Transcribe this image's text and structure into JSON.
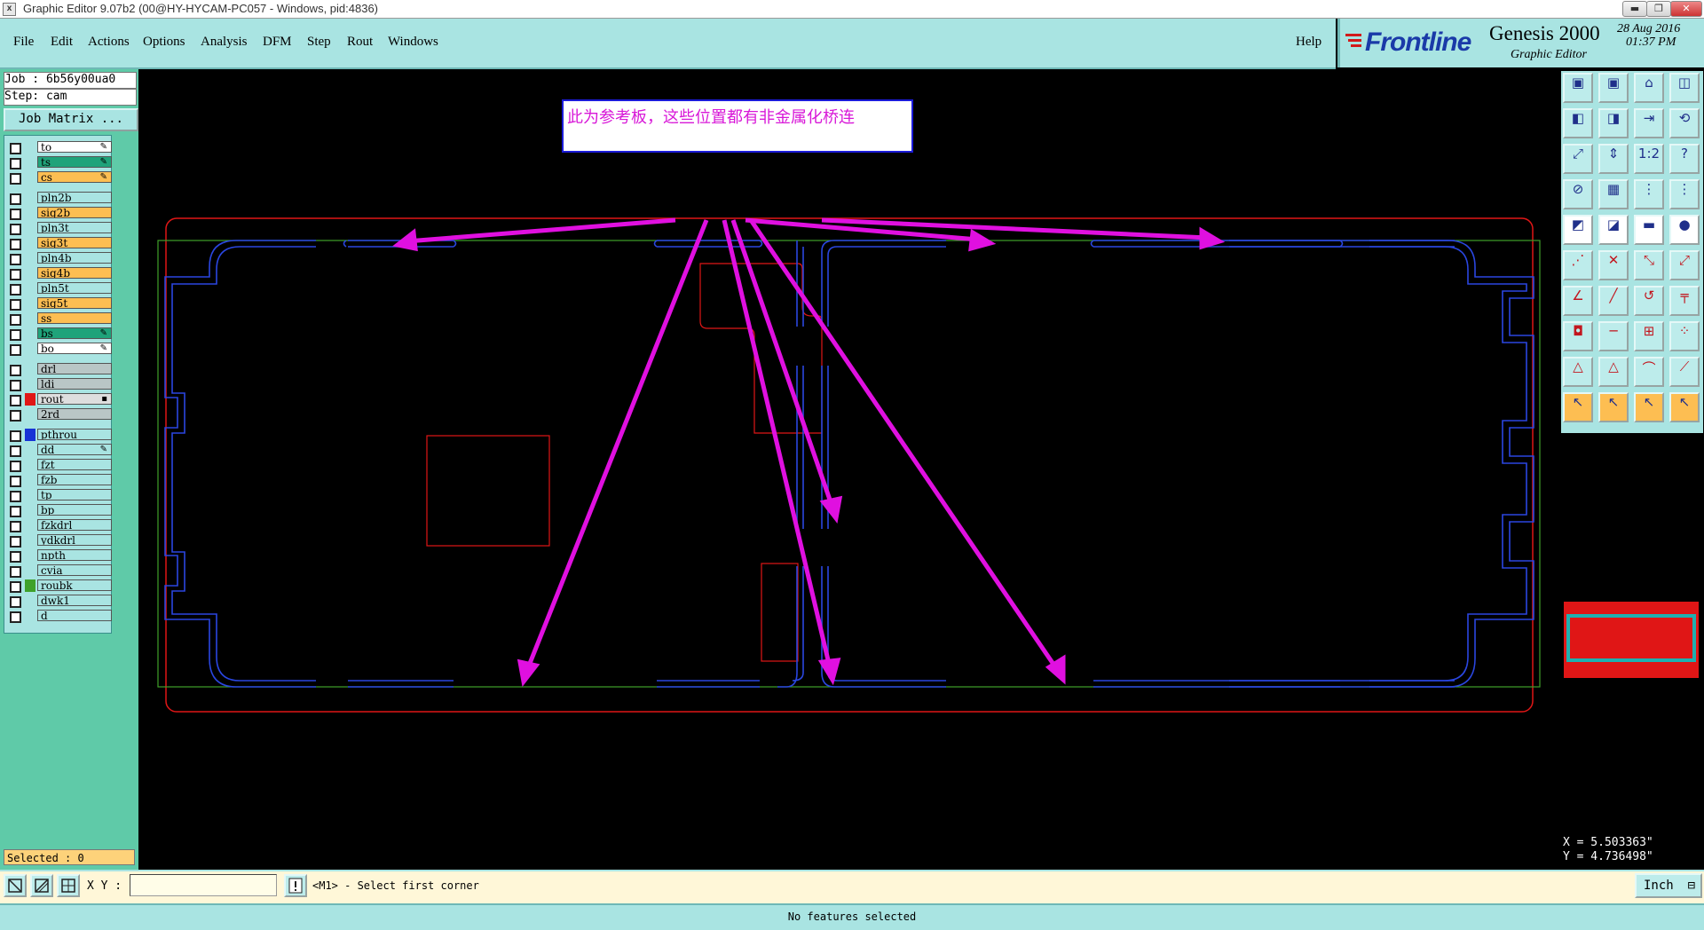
{
  "window": {
    "title": "Graphic Editor 9.07b2 (00@HY-HYCAM-PC057 - Windows, pid:4836)",
    "app_icon": "x",
    "controls": [
      "minimize-icon",
      "restore-icon",
      "close-icon"
    ]
  },
  "menu": {
    "items": [
      "File",
      "Edit",
      "Actions",
      "Options",
      "Analysis",
      "DFM",
      "Step",
      "Rout",
      "Windows"
    ],
    "help": "Help"
  },
  "logo": {
    "brand": "Frontline",
    "product": "Genesis 2000",
    "subtitle": "Graphic Editor",
    "date": "28 Aug 2016",
    "time": "01:37 PM"
  },
  "job": {
    "job_text": "Job : 6b56y00ua0",
    "step_text": "Step: cam",
    "matrix_button": "Job Matrix ..."
  },
  "layers": [
    {
      "name": "to",
      "color": "#ffffff",
      "swatch": "",
      "mark": "pencil-icon"
    },
    {
      "name": "ts",
      "color": "#1fa37a",
      "swatch": "",
      "mark": "pencil-icon"
    },
    {
      "name": "cs",
      "color": "#fdbe52",
      "swatch": "",
      "mark": "pencil-icon"
    },
    {
      "name": "pln2b",
      "color": "#a9e4e2",
      "swatch": "",
      "mark": ""
    },
    {
      "name": "sig2b",
      "color": "#fdbe52",
      "swatch": "",
      "mark": ""
    },
    {
      "name": "pln3t",
      "color": "#a9e4e2",
      "swatch": "",
      "mark": ""
    },
    {
      "name": "sig3t",
      "color": "#fdbe52",
      "swatch": "",
      "mark": ""
    },
    {
      "name": "pln4b",
      "color": "#a9e4e2",
      "swatch": "",
      "mark": ""
    },
    {
      "name": "sig4b",
      "color": "#fdbe52",
      "swatch": "",
      "mark": ""
    },
    {
      "name": "pln5t",
      "color": "#a9e4e2",
      "swatch": "",
      "mark": ""
    },
    {
      "name": "sig5t",
      "color": "#fdbe52",
      "swatch": "",
      "mark": ""
    },
    {
      "name": "ss",
      "color": "#fdbe52",
      "swatch": "",
      "mark": ""
    },
    {
      "name": "bs",
      "color": "#1fa37a",
      "swatch": "",
      "mark": "pencil-icon"
    },
    {
      "name": "bo",
      "color": "#ffffff",
      "swatch": "",
      "mark": "pencil-icon"
    },
    {
      "name": "drl",
      "color": "#b9c6c6",
      "swatch": "",
      "mark": ""
    },
    {
      "name": "ldi",
      "color": "#b9c6c6",
      "swatch": "",
      "mark": ""
    },
    {
      "name": "rout",
      "color": "#dedede",
      "swatch": "#e01616",
      "mark": "checkbox-icon"
    },
    {
      "name": "2rd",
      "color": "#b9c6c6",
      "swatch": "",
      "mark": ""
    },
    {
      "name": "pthrou",
      "color": "#a9e4e2",
      "swatch": "#1733d6",
      "mark": ""
    },
    {
      "name": "dd",
      "color": "#a9e4e2",
      "swatch": "",
      "mark": "pencil-icon"
    },
    {
      "name": "fzt",
      "color": "#a9e4e2",
      "swatch": "",
      "mark": ""
    },
    {
      "name": "fzb",
      "color": "#a9e4e2",
      "swatch": "",
      "mark": ""
    },
    {
      "name": "tp",
      "color": "#a9e4e2",
      "swatch": "",
      "mark": ""
    },
    {
      "name": "bp",
      "color": "#a9e4e2",
      "swatch": "",
      "mark": ""
    },
    {
      "name": "fzkdrl",
      "color": "#a9e4e2",
      "swatch": "",
      "mark": ""
    },
    {
      "name": "ydkdrl",
      "color": "#a9e4e2",
      "swatch": "",
      "mark": ""
    },
    {
      "name": "npth",
      "color": "#a9e4e2",
      "swatch": "",
      "mark": ""
    },
    {
      "name": "cvia",
      "color": "#a9e4e2",
      "swatch": "",
      "mark": ""
    },
    {
      "name": "roubk",
      "color": "#a9e4e2",
      "swatch": "#3fa12a",
      "mark": ""
    },
    {
      "name": "dwk1",
      "color": "#a9e4e2",
      "swatch": "",
      "mark": ""
    },
    {
      "name": "d",
      "color": "#a9e4e2",
      "swatch": "",
      "mark": ""
    }
  ],
  "selected_text": "Selected : 0",
  "annotation": {
    "text": "此为参考板，这些位置都有非金属化桥连",
    "arrow_color": "#e010e0"
  },
  "coords": {
    "x_text": "X = 5.503363\"",
    "y_text": "Y = 4.736498\""
  },
  "command": {
    "xy_label": "X Y :",
    "xy_value": "",
    "prompt": "<M1> - Select first corner",
    "units": "Inch"
  },
  "status": "No features selected",
  "tools": [
    "panel-up-icon",
    "panel-down-icon",
    "home-icon",
    "window-split-icon",
    "panel-left-icon",
    "panel-right-icon",
    "arrow-in-icon",
    "redraw-icon",
    "zoom-fit-icon",
    "zoom-area-icon",
    "scale-1-2-icon",
    "help-icon",
    "clip-icon",
    "grid-icon",
    "snap-on-icon",
    "snap-off-icon",
    "pad-add-icon",
    "surface-add-icon",
    "ruler-icon",
    "circle-icon",
    "connect-nodes-icon",
    "cross-node-icon",
    "move-node-icon",
    "add-node-icon",
    "line-angle-icon",
    "line-draw-icon",
    "arc-icon",
    "fillet-icon",
    "square-pad-icon",
    "line-edit-icon",
    "measure-icon",
    "cluster-icon",
    "triangle-icon",
    "polygon-icon",
    "arch-icon",
    "ramp-icon",
    "pointer-icon",
    "select-icon",
    "select-edit-icon",
    "multi-select-icon"
  ]
}
